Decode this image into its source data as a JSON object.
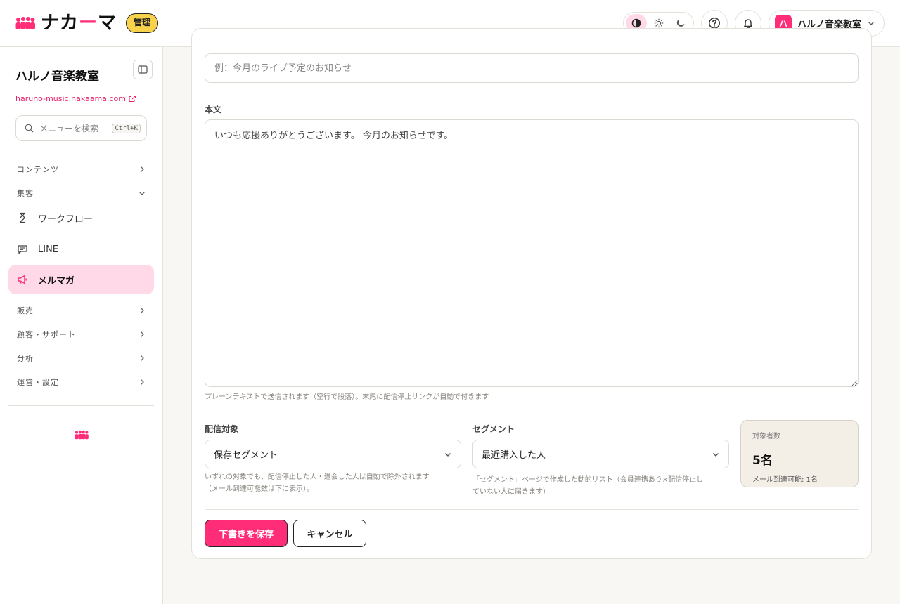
{
  "header": {
    "brand_prefix": "ナカ",
    "brand_dash": "ー",
    "brand_suffix": "マ",
    "admin_badge": "管理",
    "user_avatar_initial": "ハ",
    "user_name": "ハルノ音楽教室"
  },
  "colors": {
    "accent": "#ff2d78",
    "active_nav_bg": "#ffd9e7",
    "badge_yellow": "#f8d24a",
    "count_box_bg": "#f4efe6"
  },
  "sidebar": {
    "site_title": "ハルノ音楽教室",
    "site_url": "haruno-music.nakaama.com",
    "search_placeholder": "メニューを検索",
    "search_shortcut": "Ctrl+K",
    "sections": {
      "contents": "コンテンツ",
      "marketing": "集客",
      "sales": "販売",
      "customer_support": "顧客・サポート",
      "analytics": "分析",
      "operations": "運営・設定"
    },
    "items": {
      "workflow": "ワークフロー",
      "line": "LINE",
      "newsletter": "メルマガ"
    }
  },
  "form": {
    "subject_placeholder": "例：今月のライブ予定のお知らせ",
    "body_label": "本文",
    "body_value": "いつも応援ありがとうございます。 今月のお知らせです。",
    "body_hint": "プレーンテキストで送信されます（空行で段落）。末尾に配信停止リンクが自動で付きます",
    "target_label": "配信対象",
    "target_value": "保存セグメント",
    "target_hint_line1": "いずれの対象でも、配信停止した人・退会した人は自動で除外されます",
    "target_hint_line2": "（メール到達可能数は下に表示）。",
    "segment_label": "セグメント",
    "segment_value": "最近購入した人",
    "segment_hint_line1": "「セグメント」ページで作成した動的リスト（会員連携あり×配信停止し",
    "segment_hint_line2": "ていない人に届きます）",
    "count_label": "対象者数",
    "count_value": "5名",
    "count_sub": "メール到達可能: 1名",
    "save_draft": "下書きを保存",
    "cancel": "キャンセル"
  }
}
